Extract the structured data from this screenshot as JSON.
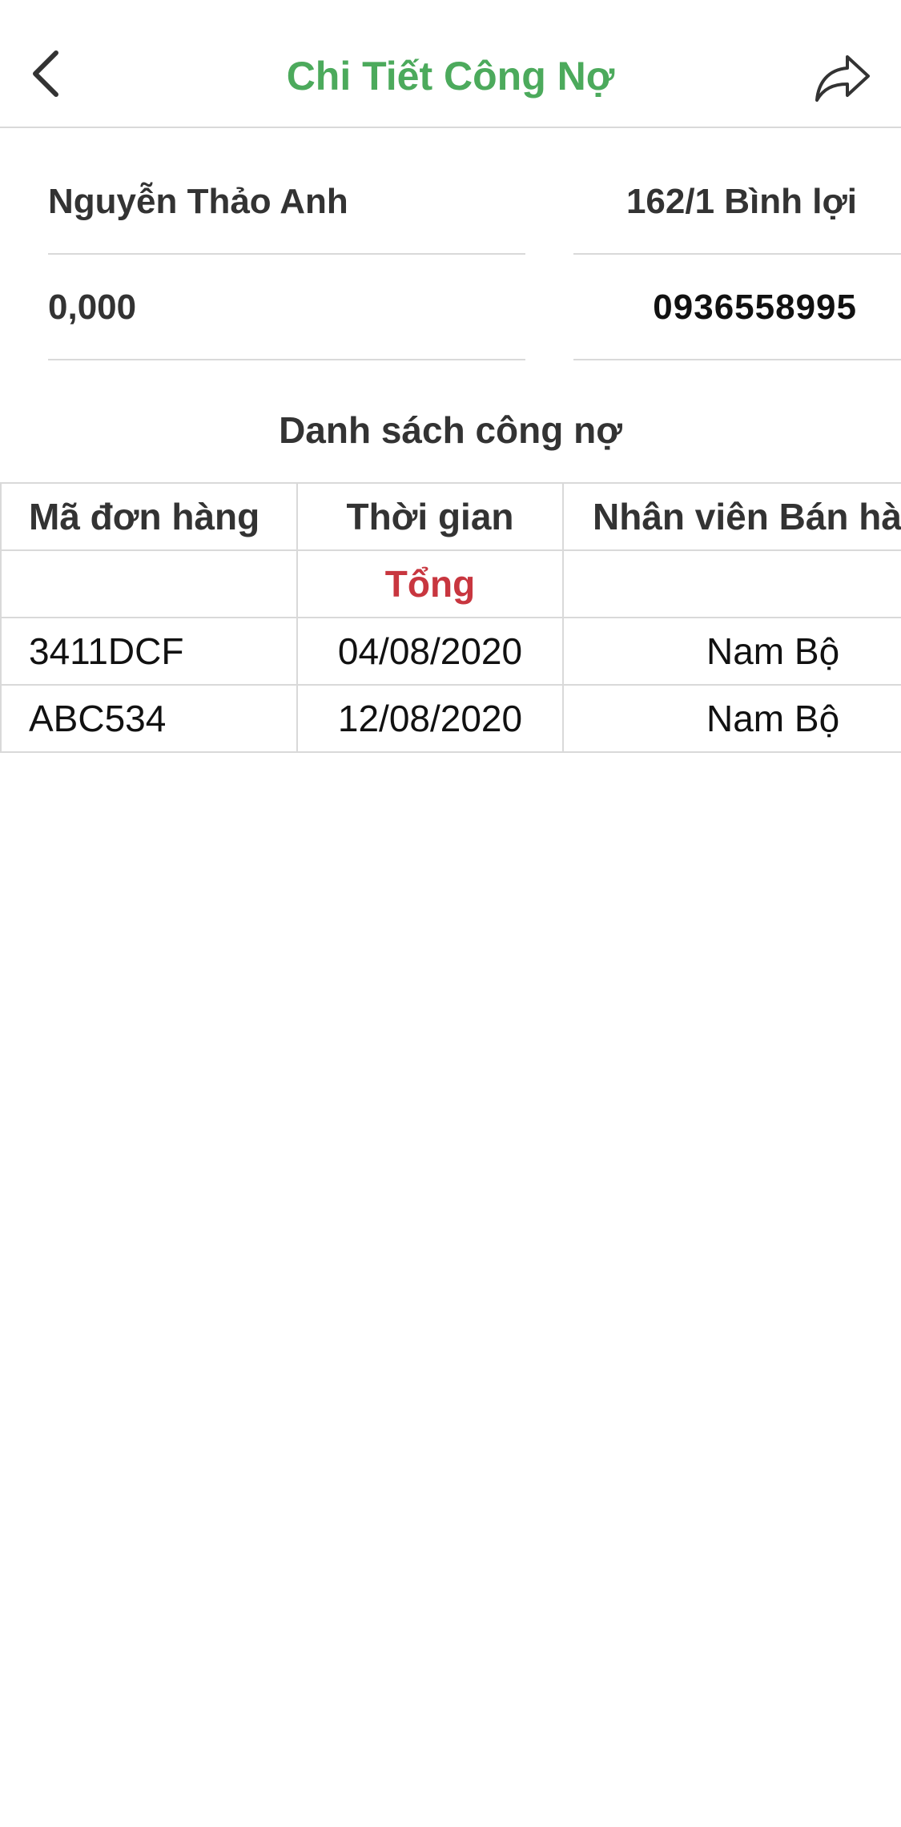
{
  "header": {
    "title": "Chi Tiết Công Nợ",
    "back_icon": "chevron-left-icon",
    "share_icon": "share-arrow-icon",
    "title_color": "#4caa5c"
  },
  "customer": {
    "name": "Nguyễn Thảo Anh",
    "address": "162/1 Bình lợi",
    "debt": "0,000",
    "phone": "0936558995"
  },
  "section_title": "Danh sách công nợ",
  "table": {
    "columns": [
      "Mã đơn hàng",
      "Thời gian",
      "Nhân viên Bán hàng"
    ],
    "total_label": "Tổng",
    "total_color": "#c8363f",
    "rows": [
      [
        "3411DCF",
        "04/08/2020",
        "Nam Bộ"
      ],
      [
        "ABC534",
        "12/08/2020",
        "Nam Bộ"
      ]
    ]
  }
}
